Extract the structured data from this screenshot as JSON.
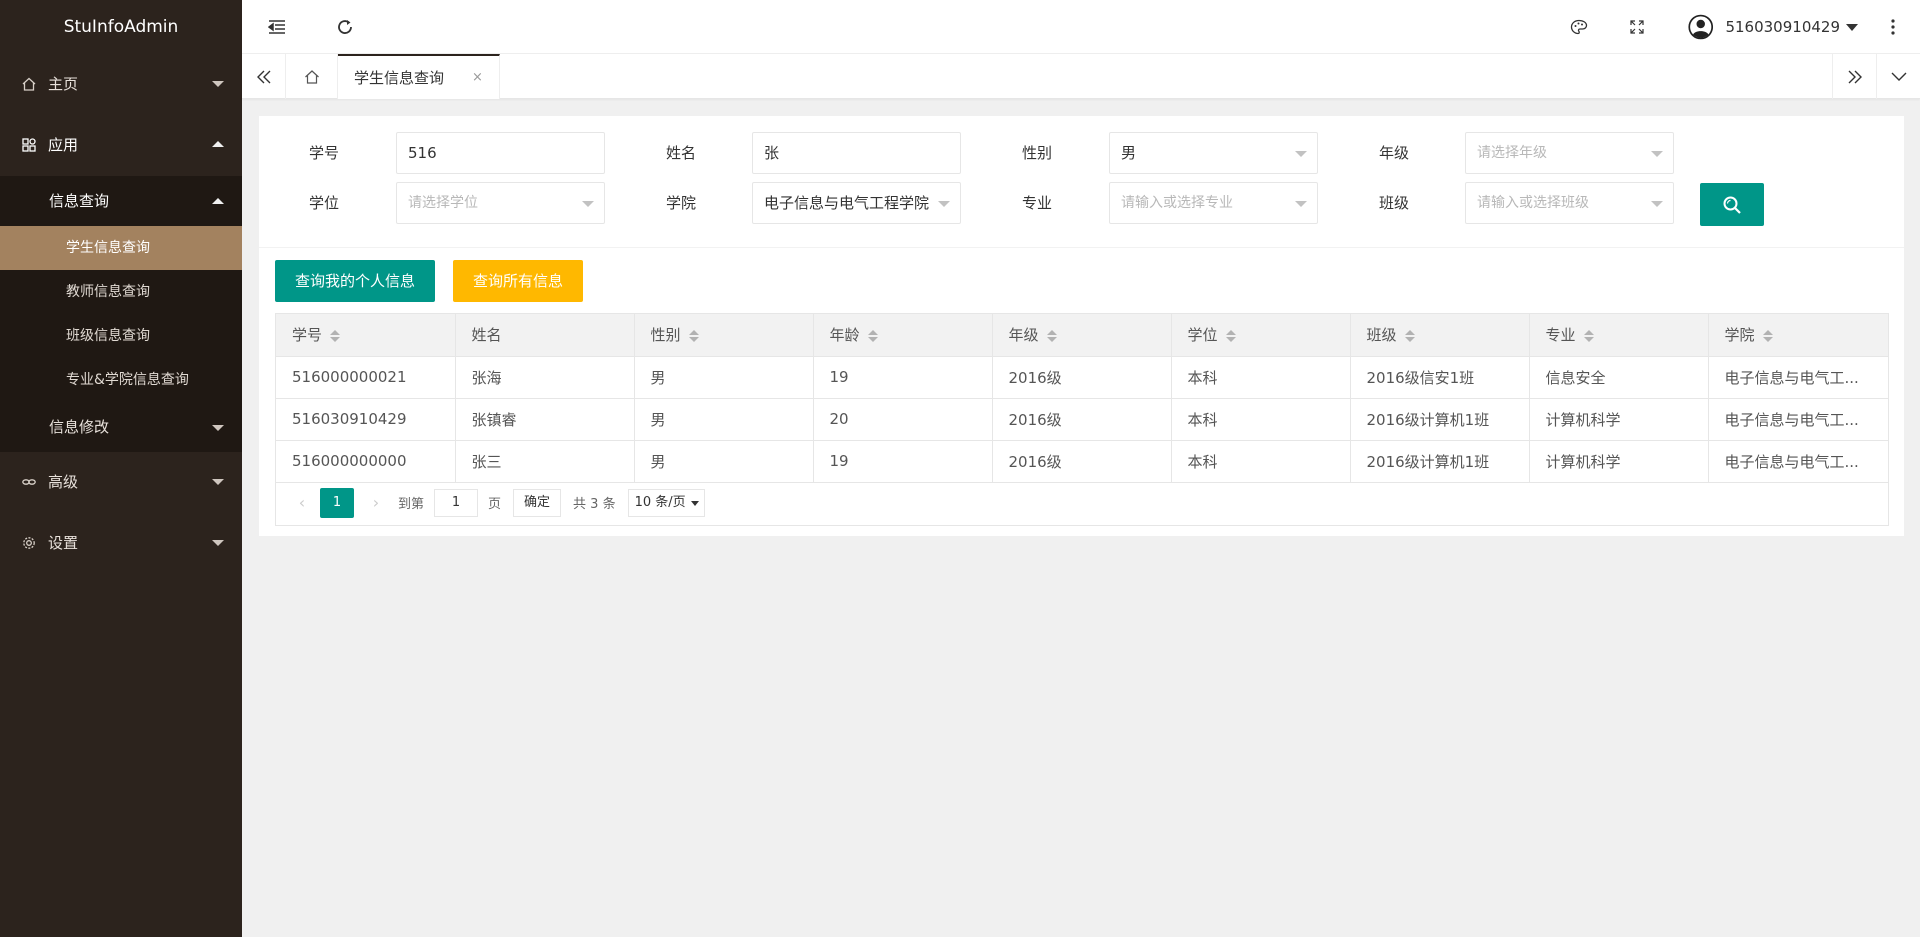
{
  "app": {
    "title": "StuInfoAdmin"
  },
  "sidebar": {
    "items": [
      {
        "label": "主页",
        "icon": "home-icon"
      },
      {
        "label": "应用",
        "icon": "apps-icon"
      },
      {
        "label": "高级",
        "icon": "link-icon"
      },
      {
        "label": "设置",
        "icon": "gear-icon"
      }
    ],
    "info_query": {
      "label": "信息查询",
      "children": [
        "学生信息查询",
        "教师信息查询",
        "班级信息查询",
        "专业&学院信息查询"
      ]
    },
    "info_edit": {
      "label": "信息修改"
    }
  },
  "header": {
    "username": "516030910429"
  },
  "tabs": [
    {
      "label": "学生信息查询",
      "close": "×"
    }
  ],
  "form": {
    "student_id": {
      "label": "学号",
      "value": "516"
    },
    "name": {
      "label": "姓名",
      "value": "张"
    },
    "gender": {
      "label": "性别",
      "value": "男"
    },
    "grade": {
      "label": "年级",
      "placeholder": "请选择年级"
    },
    "degree": {
      "label": "学位",
      "placeholder": "请选择学位"
    },
    "college": {
      "label": "学院",
      "value": "电子信息与电气工程学院"
    },
    "major": {
      "label": "专业",
      "placeholder": "请输入或选择专业"
    },
    "class": {
      "label": "班级",
      "placeholder": "请输入或选择班级"
    }
  },
  "buttons": {
    "my_info": "查询我的个人信息",
    "all_info": "查询所有信息"
  },
  "table": {
    "columns": [
      "学号",
      "姓名",
      "性别",
      "年龄",
      "年级",
      "学位",
      "班级",
      "专业",
      "学院"
    ],
    "rows": [
      [
        "516000000021",
        "张海",
        "男",
        "19",
        "2016级",
        "本科",
        "2016级信安1班",
        "信息安全",
        "电子信息与电气工..."
      ],
      [
        "516030910429",
        "张镇睿",
        "男",
        "20",
        "2016级",
        "本科",
        "2016级计算机1班",
        "计算机科学",
        "电子信息与电气工..."
      ],
      [
        "516000000000",
        "张三",
        "男",
        "19",
        "2016级",
        "本科",
        "2016级计算机1班",
        "计算机科学",
        "电子信息与电气工..."
      ]
    ]
  },
  "pager": {
    "current": "1",
    "goto_label": "到第",
    "goto_value": "1",
    "page_label": "页",
    "confirm": "确定",
    "total": "共 3 条",
    "page_size": "10 条/页"
  },
  "colors": {
    "sidebar_bg": "#2c231d",
    "active_item": "#a3825f",
    "primary": "#009688",
    "warn": "#ffb800"
  }
}
